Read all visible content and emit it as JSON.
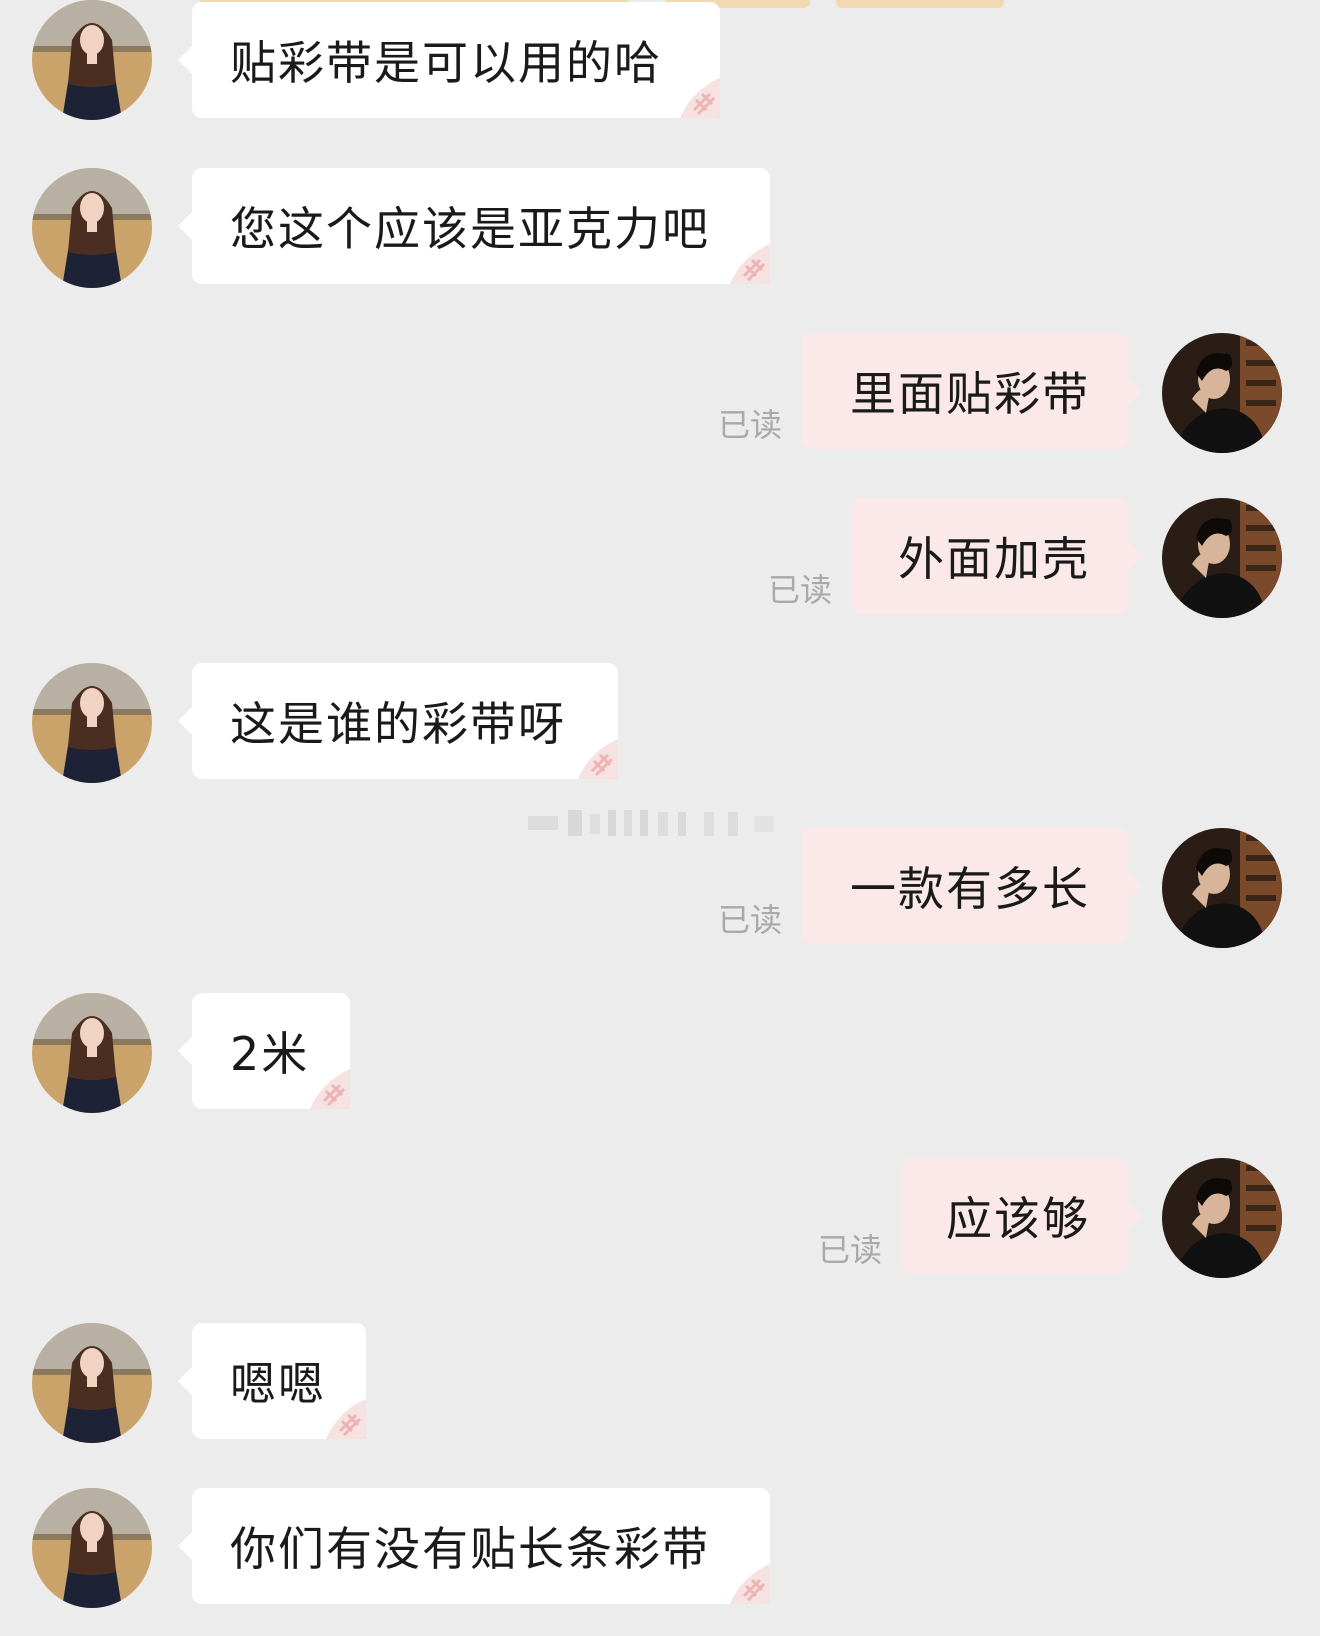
{
  "colors": {
    "background": "#ececec",
    "incoming_bubble": "#ffffff",
    "outgoing_bubble": "#fbe9e9",
    "read_receipt": "#a9a9a9",
    "chip": "#f1d9b1"
  },
  "icons": {
    "incoming_avatar": "woman-avatar-icon",
    "outgoing_avatar": "man-avatar-icon",
    "bubble_stamp": "pin-stamp-icon"
  },
  "messages": [
    {
      "direction": "incoming",
      "text": "贴彩带是可以用的哈"
    },
    {
      "direction": "incoming",
      "text": "您这个应该是亚克力吧"
    },
    {
      "direction": "outgoing",
      "text": "里面贴彩带",
      "status": "已读"
    },
    {
      "direction": "outgoing",
      "text": "外面加壳",
      "status": "已读"
    },
    {
      "direction": "incoming",
      "text": "这是谁的彩带呀"
    },
    {
      "direction": "outgoing",
      "text": "一款有多长",
      "status": "已读"
    },
    {
      "direction": "incoming",
      "text": "2米"
    },
    {
      "direction": "outgoing",
      "text": "应该够",
      "status": "已读"
    },
    {
      "direction": "incoming",
      "text": "嗯嗯"
    },
    {
      "direction": "incoming",
      "text": "你们有没有贴长条彩带"
    }
  ]
}
